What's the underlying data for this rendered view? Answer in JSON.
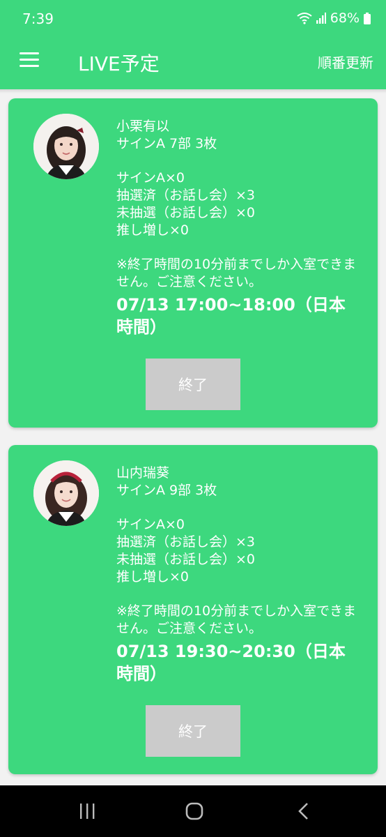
{
  "status_bar": {
    "time": "7:39",
    "battery": "68%",
    "icons": [
      "wifi-icon",
      "signal-icon",
      "battery-icon"
    ]
  },
  "app_bar": {
    "title": "LIVE予定",
    "refresh_label": "順番更新",
    "menu_icon": "hamburger-menu-icon"
  },
  "colors": {
    "primary": "#3dd87e",
    "button_disabled": "#cbcbcb",
    "background": "#f2f2f2"
  },
  "cards": [
    {
      "name": "小栗有以",
      "detail": "サインA  7部 3枚",
      "counts": [
        "サインA×0",
        "抽選済（お話し会）×3",
        "未抽選（お話し会）×0",
        "推し増し×0"
      ],
      "notice": "※終了時間の10分前までしか入室できません。ご注意ください。",
      "time": "07/13 17:00~18:00（日本時間）",
      "button_label": "終了"
    },
    {
      "name": "山内瑞葵",
      "detail": "サインA  9部 3枚",
      "counts": [
        "サインA×0",
        "抽選済（お話し会）×3",
        "未抽選（お話し会）×0",
        "推し増し×0"
      ],
      "notice": "※終了時間の10分前までしか入室できません。ご注意ください。",
      "time": "07/13 19:30~20:30（日本時間）",
      "button_label": "終了"
    }
  ],
  "nav_bar": {
    "items": [
      "recent-apps-icon",
      "home-icon",
      "back-icon"
    ]
  }
}
